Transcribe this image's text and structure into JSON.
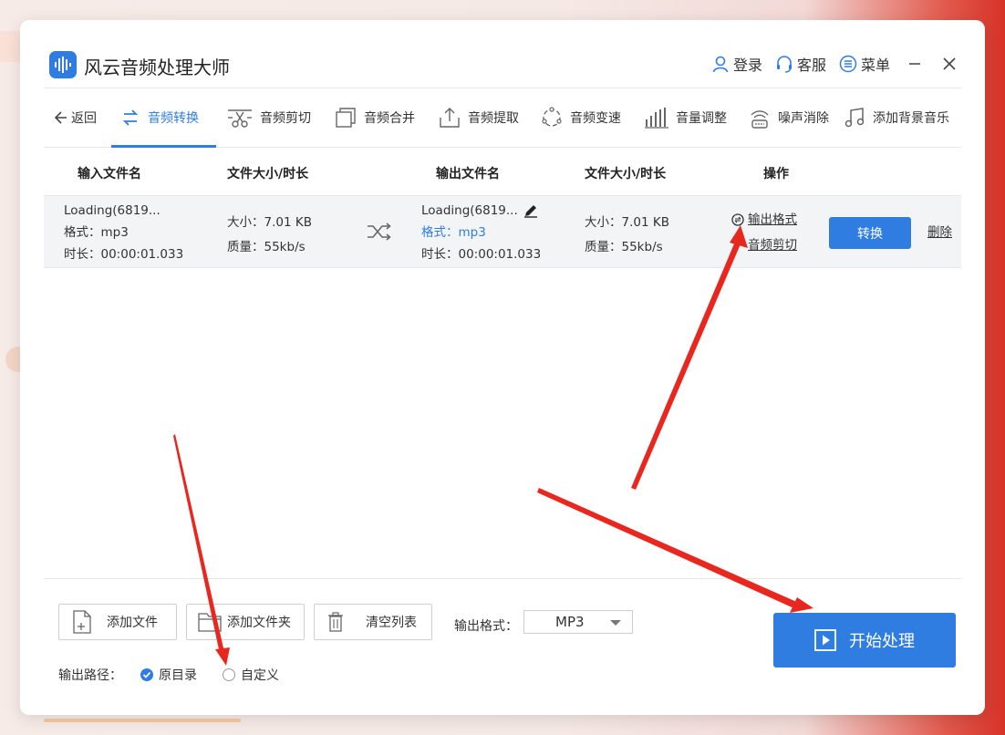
{
  "app": {
    "title": "风云音频处理大师"
  },
  "titlebar": {
    "login": "登录",
    "service": "客服",
    "menu": "菜单"
  },
  "toolbar": {
    "back": "返回",
    "tools": [
      "音频转换",
      "音频剪切",
      "音频合并",
      "音频提取",
      "音频变速",
      "音量调整",
      "噪声消除",
      "添加背景音乐"
    ],
    "active_index": 0
  },
  "table": {
    "headers": {
      "input_name": "输入文件名",
      "input_size": "文件大小/时长",
      "output_name": "输出文件名",
      "output_size": "文件大小/时长",
      "actions": "操作"
    },
    "row": {
      "input_name": "Loading(6819...",
      "input_format": "格式：mp3",
      "input_duration": "时长：00:00:01.033",
      "input_size": "大小：7.01 KB",
      "input_quality": "质量：55kb/s",
      "output_name": "Loading(6819...",
      "output_format": "格式：mp3",
      "output_duration": "时长：00:00:01.033",
      "output_size": "大小：7.01 KB",
      "output_quality": "质量：55kb/s",
      "action_format": "输出格式",
      "action_cut": "音频剪切",
      "convert": "转换",
      "delete": "删除"
    }
  },
  "bottom": {
    "add_file": "添加文件",
    "add_folder": "添加文件夹",
    "clear_list": "清空列表",
    "format_label": "输出格式：",
    "format_value": "MP3",
    "start": "开始处理",
    "path_label": "输出路径：",
    "path_original": "原目录",
    "path_custom": "自定义",
    "path_selected": "原目录"
  },
  "colors": {
    "accent": "#2f7de1",
    "annotation": "#e8281f"
  }
}
